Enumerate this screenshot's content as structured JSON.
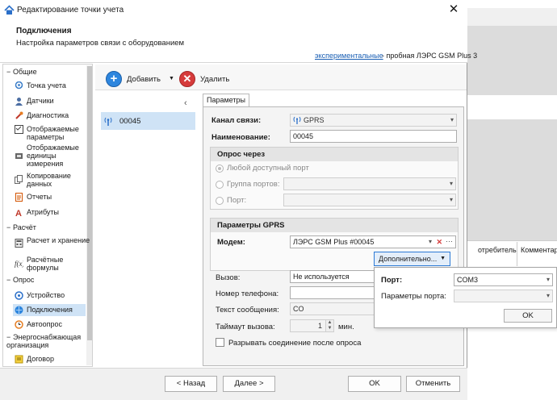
{
  "window": {
    "title": "Редактирование точки учета",
    "close_glyph": "✕"
  },
  "header": {
    "title": "Подключения",
    "subtitle": "Настройка параметров связи с оборудованием",
    "experimental_link": "экспериментальные",
    "trial_text": "- пробная ЛЭРС GSM Plus 3"
  },
  "nav": {
    "groups": [
      {
        "label": "Общие",
        "items": [
          {
            "label": "Точка учета",
            "icon": "map-pin-icon"
          },
          {
            "label": "Датчики",
            "icon": "sensor-icon"
          },
          {
            "label": "Диагностика",
            "icon": "diagnostics-icon"
          },
          {
            "label": "Отображаемые параметры",
            "icon": "checklist-icon"
          },
          {
            "label": "Отображаемые единицы измерения",
            "icon": "units-icon"
          },
          {
            "label": "Копирование данных",
            "icon": "copy-icon"
          },
          {
            "label": "Отчеты",
            "icon": "report-icon"
          },
          {
            "label": "Атрибуты",
            "icon": "attribute-icon"
          }
        ]
      },
      {
        "label": "Расчёт",
        "items": [
          {
            "label": "Расчет и хранение",
            "icon": "calc-icon"
          },
          {
            "label": "Расчётные формулы",
            "icon": "formula-icon"
          }
        ]
      },
      {
        "label": "Опрос",
        "items": [
          {
            "label": "Устройство",
            "icon": "device-icon"
          },
          {
            "label": "Подключения",
            "icon": "connection-icon"
          },
          {
            "label": "Автоопрос",
            "icon": "clock-icon"
          }
        ]
      },
      {
        "label": "Энергоснабжающая организация",
        "items": [
          {
            "label": "Договор",
            "icon": "contract-icon"
          }
        ]
      }
    ]
  },
  "toolbar": {
    "add_label": "Добавить",
    "delete_label": "Удалить"
  },
  "list": {
    "chevron": "‹",
    "items": [
      {
        "label": "00045"
      }
    ]
  },
  "params": {
    "tab": "Параметры",
    "channel_label": "Канал связи:",
    "channel_value": "GPRS",
    "name_label": "Наименование:",
    "name_value": "00045",
    "poll_section": "Опрос через",
    "any_port": "Любой доступный порт",
    "port_group": "Группа портов:",
    "port": "Порт:",
    "gprs_section": "Параметры GPRS",
    "modem_label": "Модем:",
    "modem_value": "ЛЭРС GSM Plus #00045",
    "more_button": "Дополнительно...",
    "call_label": "Вызов:",
    "call_value": "Не используется",
    "phone_label": "Номер телефона:",
    "message_label": "Текст сообщения:",
    "message_value": "CO",
    "timeout_label": "Таймаут вызова:",
    "timeout_value": "1",
    "timeout_unit": "мин.",
    "disconnect_label": "Разрывать соединение после опроса"
  },
  "popup": {
    "port_label": "Порт:",
    "port_value": "COM3",
    "port_params_label": "Параметры порта:",
    "ok": "OK"
  },
  "footer": {
    "back": "< Назад",
    "next": "Далее >",
    "ok": "OK",
    "cancel": "Отменить"
  },
  "background": {
    "col1": "отребитель",
    "col2": "Комментар"
  }
}
